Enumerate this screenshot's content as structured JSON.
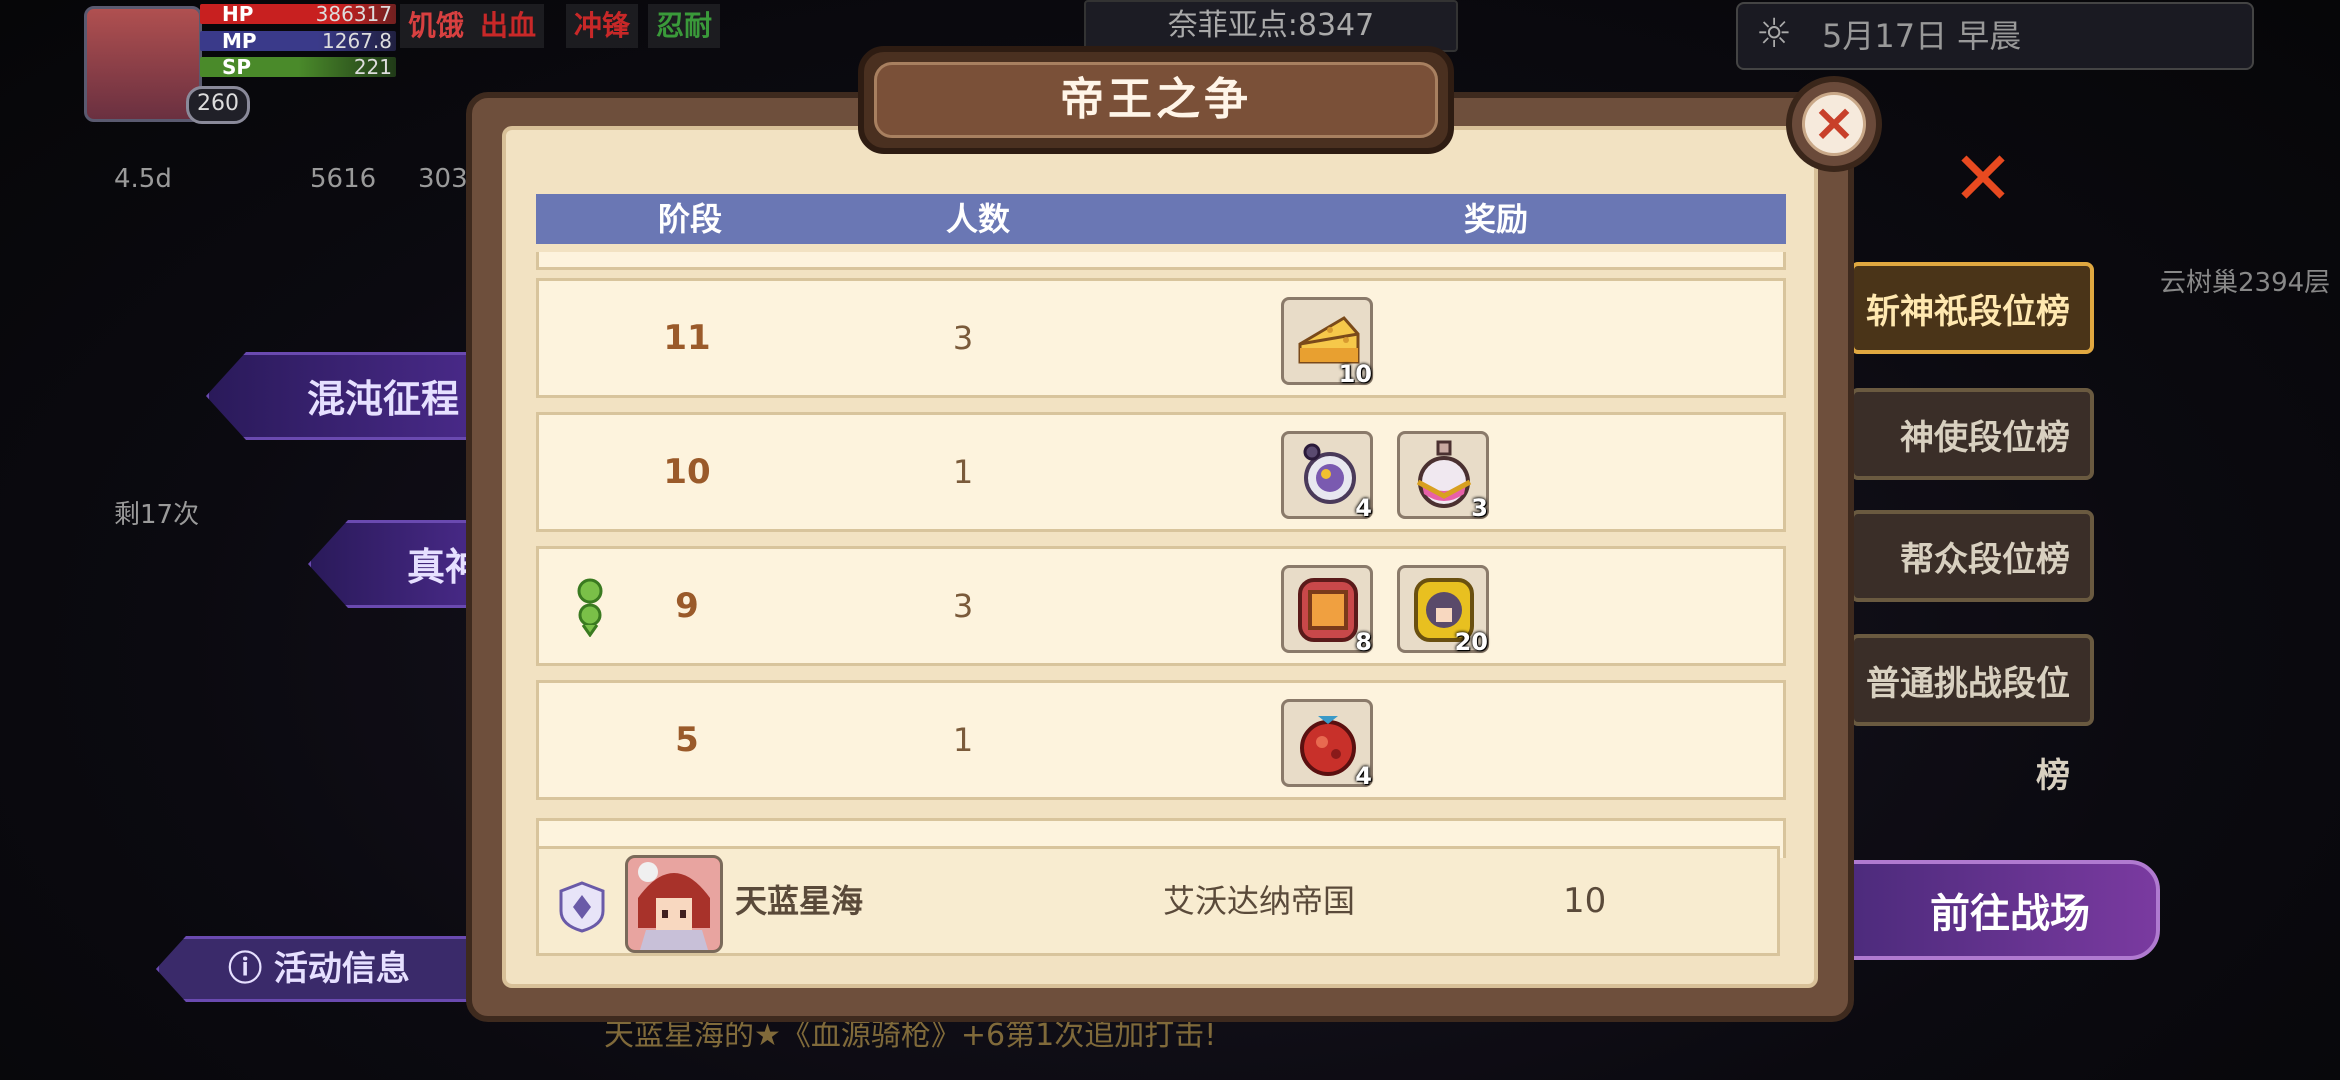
{
  "player": {
    "level": "260",
    "hp_label": "HP",
    "hp": "386317",
    "mp_label": "MP",
    "mp": "1267.8",
    "sp_label": "SP",
    "sp": "221",
    "statuses": [
      {
        "label": "饥饿",
        "color": "#d84040"
      },
      {
        "label": "出血",
        "color": "#c82828"
      },
      {
        "label": "冲锋",
        "color": "#c82828"
      },
      {
        "label": "忍耐",
        "color": "#3a9a3a"
      }
    ],
    "resources": [
      "4.5d",
      "5616",
      "303"
    ]
  },
  "top": {
    "currency": "奈菲亚点:8347",
    "date": "5月17日 早晨"
  },
  "left": {
    "banner1": "混沌征程",
    "banner2": "真神",
    "remaining": "剩17次",
    "info_button": "活动信息"
  },
  "right": {
    "tabs": [
      "斩神祇段位榜",
      "神使段位榜",
      "帮众段位榜",
      "普通挑战段位榜"
    ],
    "go_battle": "前往战场",
    "tree_text": "云树巢2394层"
  },
  "ticker": "天蓝星海的★《血源骑枪》+6第1次追加打击!",
  "dialog": {
    "title": "帝王之争",
    "close": "×",
    "headers": {
      "stage": "阶段",
      "count": "人数",
      "reward": "奖励"
    },
    "rows": [
      {
        "stage": "11",
        "count": "3",
        "pinned": false,
        "rewards": [
          {
            "icon": "cheese-icon",
            "count": "10"
          }
        ]
      },
      {
        "stage": "10",
        "count": "1",
        "pinned": false,
        "rewards": [
          {
            "icon": "gem-ring-icon",
            "count": "4"
          },
          {
            "icon": "pink-potion-icon",
            "count": "3"
          }
        ]
      },
      {
        "stage": "9",
        "count": "3",
        "pinned": true,
        "rewards": [
          {
            "icon": "frame-token-icon",
            "count": "8"
          },
          {
            "icon": "portrait-coin-icon",
            "count": "20"
          }
        ]
      },
      {
        "stage": "5",
        "count": "1",
        "pinned": false,
        "rewards": [
          {
            "icon": "red-fruit-icon",
            "count": "4"
          }
        ]
      }
    ],
    "self": {
      "name": "天蓝星海",
      "nation": "艾沃达纳帝国",
      "stage": "10"
    }
  },
  "colors": {
    "header_blue": "#6a77b4",
    "stage_brown": "#9a5a2a",
    "dialog_frame": "#6e4f3c",
    "dialog_paper": "#f2e2c2",
    "close_red": "#c8402a"
  }
}
